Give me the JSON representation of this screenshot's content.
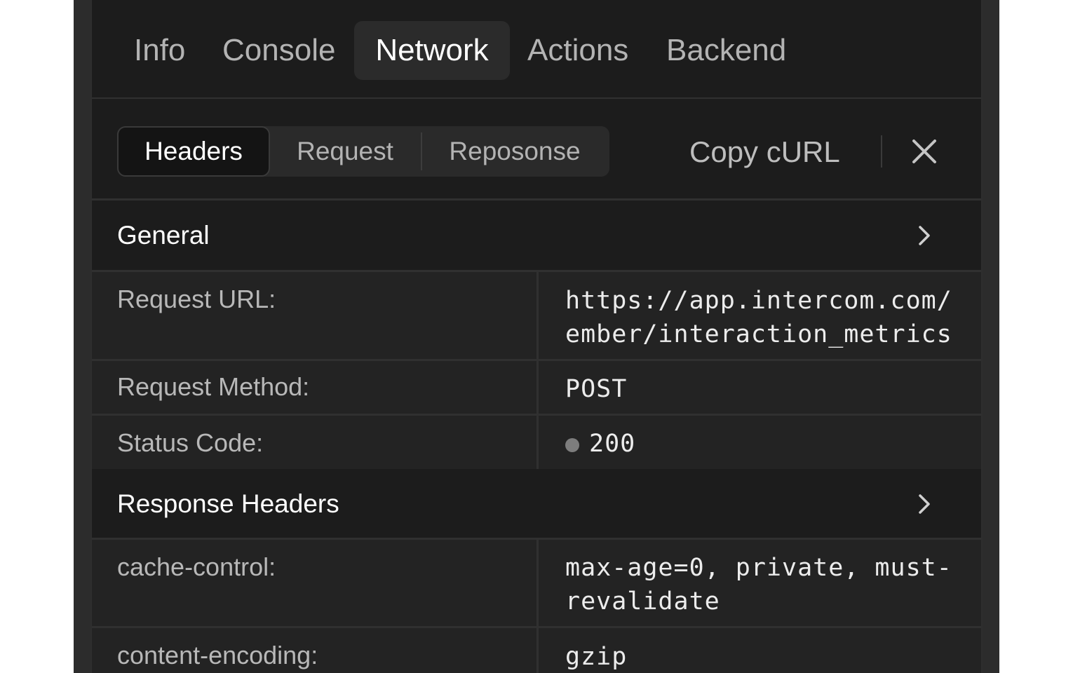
{
  "tabs": [
    {
      "label": "Info"
    },
    {
      "label": "Console"
    },
    {
      "label": "Network",
      "active": true
    },
    {
      "label": "Actions"
    },
    {
      "label": "Backend"
    }
  ],
  "subtabs": [
    {
      "label": "Headers",
      "active": true
    },
    {
      "label": "Request"
    },
    {
      "label": "Reposonse"
    }
  ],
  "toolbar": {
    "copy_curl": "Copy cURL",
    "close_icon": "close-icon"
  },
  "general": {
    "title": "General",
    "rows": [
      {
        "key": "Request URL:",
        "value": "https://app.intercom.com/\nember/interaction_metrics"
      },
      {
        "key": "Request Method:",
        "value": "POST"
      },
      {
        "key": "Status Code:",
        "value": "200",
        "status_color": "#7d7d7d"
      }
    ]
  },
  "response_headers": {
    "title": "Response Headers",
    "rows": [
      {
        "key": "cache-control:",
        "value": "max-age=0, private, must-\nrevalidate"
      },
      {
        "key": "content-encoding:",
        "value": "gzip"
      }
    ]
  },
  "colors": {
    "panel_bg": "#1c1c1c",
    "row_bg": "#232323",
    "active_tab_bg": "#2b2b2b"
  }
}
